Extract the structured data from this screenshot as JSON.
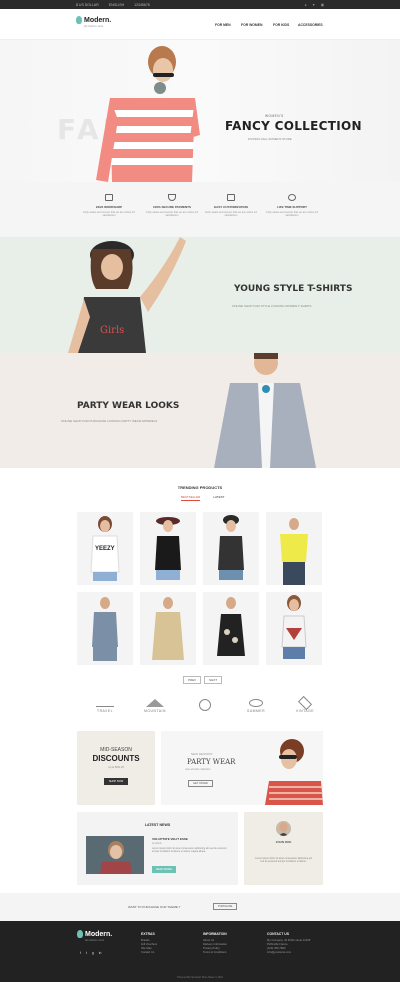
{
  "topbar": {
    "currency": "$ US DOLLAR",
    "language": "ENGLISH",
    "phone": "12345678",
    "links": [
      "",
      "",
      ""
    ]
  },
  "header": {
    "logo": "Modern.",
    "tagline": "the fashion store",
    "nav": [
      "FOR MEN",
      "FOR WOMEN",
      "FOR KIDS",
      "ACCESSORIES"
    ]
  },
  "hero": {
    "background_word": "FANCY",
    "eyebrow": "WOMEN'S",
    "title": "FANCY COLLECTION",
    "subtitle": "DIVINING FALL WOMENS STORE"
  },
  "features": [
    {
      "title": "24/24 WORKSHOP",
      "desc": "Fully aware and secure that we are online 24 satisfaction"
    },
    {
      "title": "100% SECURE PAYMENTS",
      "desc": "Fully aware and secure that we are online 24 satisfaction"
    },
    {
      "title": "EASY CUSTOMIZATION",
      "desc": "Fully aware and secure that we are online 24 satisfaction"
    },
    {
      "title": "LIFE TIME SUPPORT",
      "desc": "Fully aware and secure that we are online 24 satisfaction"
    }
  ],
  "band1": {
    "title": "YOUNG STYLE T-SHIRTS",
    "subtitle": "ONLINE SHOP FOR STYLE LOOKING WOMEN T-SHIRTS"
  },
  "band2": {
    "title": "PARTY WEAR LOOKS",
    "subtitle": "ONLINE SHOP FOR PURCHASE LOOKING PARTY WEAR APPARELS"
  },
  "trending": {
    "title": "TRENDING PRODUCTS",
    "tabs": [
      "BESTSELLER",
      "LATEST"
    ],
    "pager": [
      "PREV",
      "NEXT"
    ]
  },
  "brands": [
    "TRAVEL",
    "MOUNTAIN",
    "",
    "SUMMER",
    "VINTAGE"
  ],
  "promo1": {
    "eyebrow": "MID-SEASON",
    "title": "DISCOUNTS",
    "note": "up to 50% off",
    "button": "SHOP NOW"
  },
  "promo2": {
    "eyebrow": "NEW DESIGNS",
    "title": "PARTY WEAR",
    "note": "new arrivals collection",
    "button": "GET OFFER"
  },
  "news": {
    "heading": "LATEST NEWS",
    "title": "VOLUPTATE VELIT ESSE",
    "meta": "by Admin",
    "body": "Lorem ipsum dolor sit amet consectetur adipiscing elit sed do eiusmod tempor incididunt ut labore et dolore magna aliqua.",
    "button": "READ MORE"
  },
  "testimonial": {
    "name": "JOHN DOE",
    "quote": "Lorem ipsum dolor sit amet consectetur adipiscing elit sed do eiusmod tempor incididunt ut labore."
  },
  "cta": {
    "message": "WANT TO PURCHASE OUR THEME ?",
    "button": "PURCHASE"
  },
  "footer": {
    "logo": "Modern.",
    "tagline": "the fashion store",
    "social": [
      "f",
      "t",
      "g",
      "in"
    ],
    "columns": [
      {
        "heading": "EXTRAS",
        "items": [
          "Brands",
          "Gift Vouchers",
          "Site Map",
          "Contact Us"
        ]
      },
      {
        "heading": "INFORMATION",
        "items": [
          "About Us",
          "Delivery Information",
          "Privacy Policy",
          "Terms & Conditions"
        ]
      },
      {
        "heading": "CONTACT US",
        "items": [
          "My Company, 42 Puffin street 12345",
          "Puffinville France",
          "(123) 456-7890",
          "info@yourstore.com"
        ]
      }
    ],
    "copyright": "Powered By OpenCart Store Name © 2024"
  },
  "colors": {
    "accent": "#6cc3b5",
    "sale": "#d94f3a",
    "dark": "#222222"
  }
}
